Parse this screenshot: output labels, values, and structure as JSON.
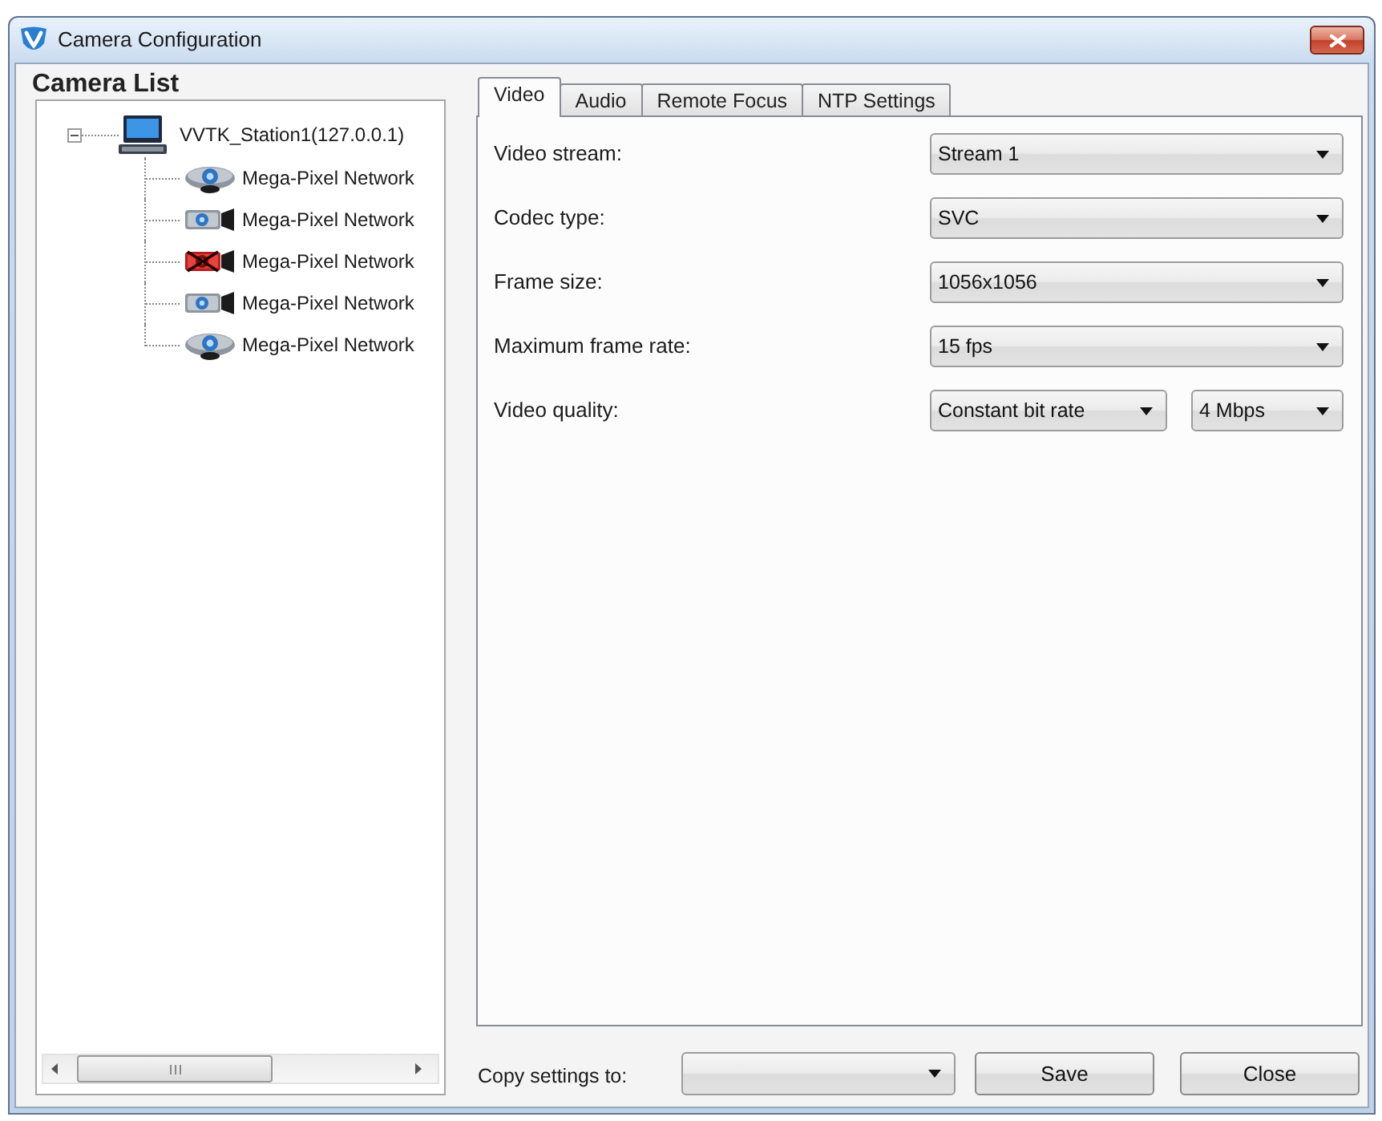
{
  "window": {
    "title": "Camera Configuration"
  },
  "camera_list": {
    "title": "Camera List",
    "tree": [
      {
        "label": "VVTK_Station1(127.0.0.1)",
        "kind": "station",
        "expanded": true,
        "children": [
          {
            "label": "Mega-Pixel Network",
            "kind": "dome",
            "offline": false
          },
          {
            "label": "Mega-Pixel Network",
            "kind": "box",
            "offline": false
          },
          {
            "label": "Mega-Pixel Network",
            "kind": "box",
            "offline": true
          },
          {
            "label": "Mega-Pixel Network",
            "kind": "box",
            "offline": false
          },
          {
            "label": "Mega-Pixel Network",
            "kind": "dome",
            "offline": false
          }
        ]
      }
    ]
  },
  "tabs": [
    {
      "label": "Video",
      "selected": true
    },
    {
      "label": "Audio",
      "selected": false
    },
    {
      "label": "Remote Focus",
      "selected": false
    },
    {
      "label": "NTP Settings",
      "selected": false
    }
  ],
  "video_settings": [
    {
      "label": "Video stream:",
      "dropdowns": [
        {
          "value": "Stream 1"
        }
      ]
    },
    {
      "label": "Codec type:",
      "dropdowns": [
        {
          "value": "SVC"
        }
      ]
    },
    {
      "label": "Frame size:",
      "dropdowns": [
        {
          "value": "1056x1056"
        }
      ]
    },
    {
      "label": "Maximum frame rate:",
      "dropdowns": [
        {
          "value": "15 fps"
        }
      ]
    },
    {
      "label": "Video quality:",
      "dropdowns": [
        {
          "value": "Constant bit rate"
        },
        {
          "value": "4 Mbps"
        }
      ]
    }
  ],
  "footer": {
    "copy_settings": {
      "label": "Copy settings to:"
    },
    "buttons": [
      "Save",
      "Close"
    ]
  }
}
